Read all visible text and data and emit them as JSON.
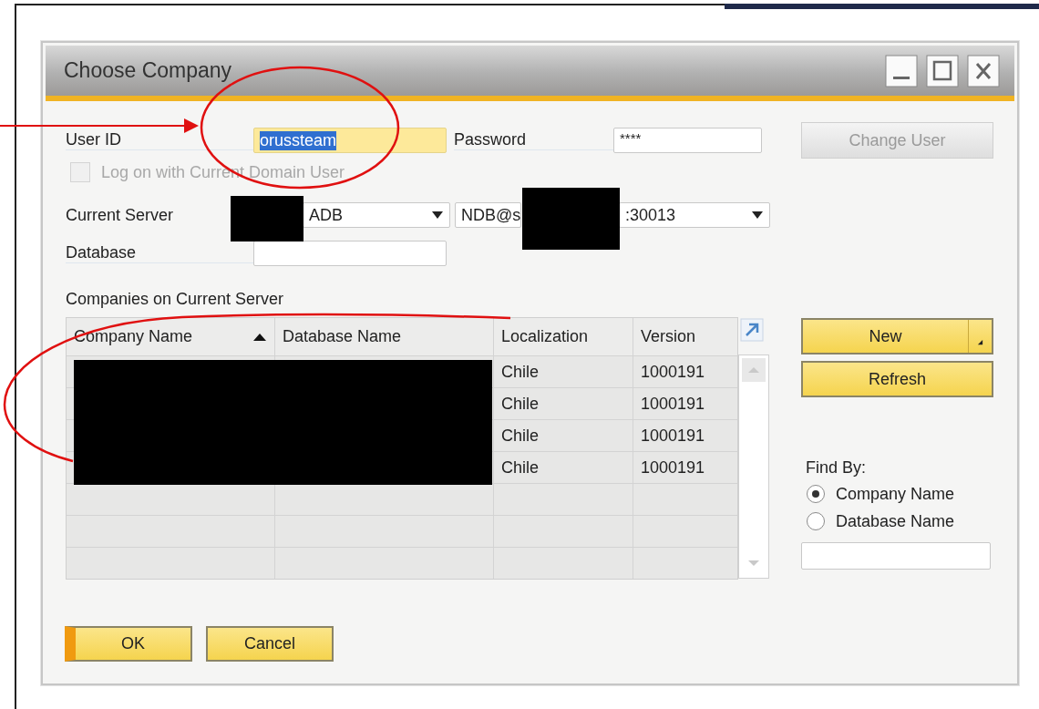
{
  "window": {
    "title": "Choose Company"
  },
  "login": {
    "user_id": {
      "label": "User ID",
      "value": "orussteam",
      "focused": true
    },
    "password": {
      "label": "Password",
      "value": "****"
    },
    "change_user": {
      "label": "Change User",
      "disabled": true
    },
    "domain_logon": {
      "label": "Log on with Current Domain User",
      "checked": false,
      "disabled": true
    }
  },
  "server": {
    "label": "Current Server",
    "type": "ADB",
    "address_start": "NDB@s",
    "address_end": ":30013"
  },
  "database": {
    "label": "Database"
  },
  "companies": {
    "title": "Companies on Current Server",
    "columns": [
      {
        "label": "Company Name",
        "sorted_ascending": true
      },
      {
        "label": "Database Name",
        "sorted_ascending": false
      },
      {
        "label": "Localization",
        "sorted_ascending": false
      },
      {
        "label": "Version",
        "sorted_ascending": false
      }
    ],
    "rows": [
      {
        "localization": "Chile",
        "version": "1000191"
      },
      {
        "localization": "Chile",
        "version": "1000191"
      },
      {
        "localization": "Chile",
        "version": "1000191"
      },
      {
        "localization": "Chile",
        "version": "1000191"
      }
    ]
  },
  "side_buttons": [
    {
      "label": "New",
      "has_menu": true
    },
    {
      "label": "Refresh",
      "has_menu": false
    }
  ],
  "find_by": {
    "label": "Find By:",
    "options": [
      {
        "label": "Company Name",
        "selected": true
      },
      {
        "label": "Database Name",
        "selected": false
      }
    ]
  },
  "footer_buttons": [
    {
      "label": "OK",
      "default": true
    },
    {
      "label": "Cancel",
      "default": false
    }
  ]
}
